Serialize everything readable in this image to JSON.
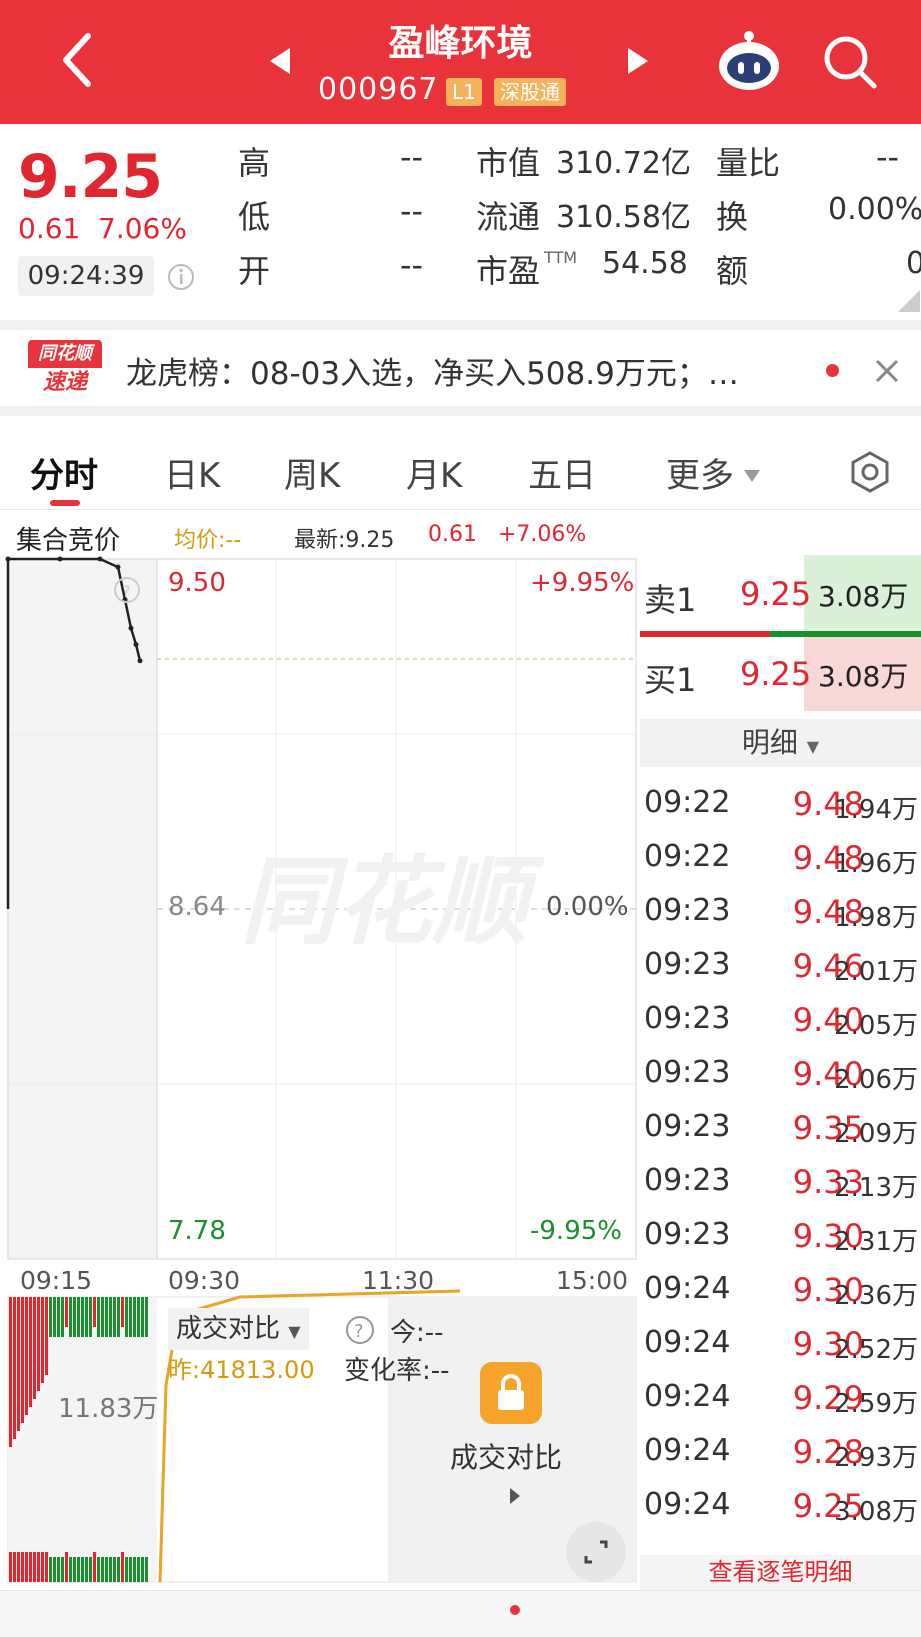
{
  "header": {
    "stock_name": "盈峰环境",
    "stock_code": "000967",
    "level_badge": "L1",
    "connect_badge": "深股通",
    "back_icon": "chevron-left-icon",
    "prev_icon": "triangle-left-icon",
    "next_icon": "triangle-right-icon",
    "robot_icon": "robot-assistant-icon",
    "search_icon": "search-icon",
    "brand_color": "#e8333b"
  },
  "quote": {
    "price": "9.25",
    "change": "0.61",
    "change_pct": "7.06%",
    "time": "09:24:39",
    "high_label": "高",
    "high_value": "--",
    "low_label": "低",
    "low_value": "--",
    "open_label": "开",
    "open_value": "--",
    "mktcap_label": "市值",
    "mktcap_value": "310.72亿",
    "float_label": "流通",
    "float_value": "310.58亿",
    "pe_label": "市盈",
    "pe_suffix": "TTM",
    "pe_value": "54.58",
    "volratio_label": "量比",
    "volratio_value": "--",
    "turnover_label": "换",
    "turnover_value": "0.00%",
    "amount_label": "额",
    "amount_value": "0"
  },
  "news": {
    "logo_top": "同花顺",
    "logo_bottom": "速递",
    "text": "龙虎榜：08-03入选，净买入508.9万元；…",
    "close_icon": "close-icon"
  },
  "tabs": [
    "分时",
    "日K",
    "周K",
    "月K",
    "五日",
    "更多"
  ],
  "tabs_active": "分时",
  "settings_icon": "hexagon-settings-icon",
  "chart_header": {
    "auction_label": "集合竞价",
    "avg_label": "均价:--",
    "latest_label": "最新:9.25",
    "latest_change": "0.61",
    "latest_pct": "+7.06%"
  },
  "chart_data": {
    "type": "line",
    "y_left_ticks": [
      "9.50",
      "8.64",
      "7.78"
    ],
    "y_right_ticks": [
      "+9.95%",
      "0.00%",
      "-9.95%"
    ],
    "x_ticks": [
      "09:15",
      "09:30",
      "11:30",
      "15:00"
    ],
    "ylim": [
      7.78,
      9.5
    ],
    "prev_close": 8.64,
    "auction_series": [
      {
        "t": "09:15",
        "v": 9.5
      },
      {
        "t": "09:20",
        "v": 9.5
      },
      {
        "t": "09:21",
        "v": 9.5
      },
      {
        "t": "09:22",
        "v": 9.48
      },
      {
        "t": "09:23",
        "v": 9.4
      },
      {
        "t": "09:23",
        "v": 9.33
      },
      {
        "t": "09:24",
        "v": 9.29
      },
      {
        "t": "09:24",
        "v": 9.25
      }
    ],
    "volume_label": "11.83万",
    "watermark": "同花顺"
  },
  "volume_panel": {
    "compare_label": "成交对比",
    "today_label": "今:--",
    "yesterday_label": "昨:41813.00",
    "change_rate_label": "变化率:--",
    "lock_label": "成交对比",
    "lock_icon": "lock-icon",
    "expand_icon": "expand-icon",
    "help_icon": "question-icon"
  },
  "order_book": {
    "sell_label": "卖1",
    "sell_price": "9.25",
    "sell_vol": "3.08万",
    "buy_label": "买1",
    "buy_price": "9.25",
    "buy_vol": "3.08万",
    "detail_label": "明细",
    "view_all_label": "查看逐笔明细"
  },
  "trades": [
    {
      "time": "09:22",
      "price": "9.48",
      "vol": "1.94万"
    },
    {
      "time": "09:22",
      "price": "9.48",
      "vol": "1.96万"
    },
    {
      "time": "09:23",
      "price": "9.48",
      "vol": "1.98万"
    },
    {
      "time": "09:23",
      "price": "9.46",
      "vol": "2.01万"
    },
    {
      "time": "09:23",
      "price": "9.40",
      "vol": "2.05万"
    },
    {
      "time": "09:23",
      "price": "9.40",
      "vol": "2.06万"
    },
    {
      "time": "09:23",
      "price": "9.35",
      "vol": "2.09万"
    },
    {
      "time": "09:23",
      "price": "9.33",
      "vol": "2.13万"
    },
    {
      "time": "09:23",
      "price": "9.30",
      "vol": "2.31万"
    },
    {
      "time": "09:24",
      "price": "9.30",
      "vol": "2.36万"
    },
    {
      "time": "09:24",
      "price": "9.30",
      "vol": "2.52万"
    },
    {
      "time": "09:24",
      "price": "9.29",
      "vol": "2.59万"
    },
    {
      "time": "09:24",
      "price": "9.28",
      "vol": "2.93万"
    },
    {
      "time": "09:24",
      "price": "9.25",
      "vol": "3.08万"
    }
  ]
}
